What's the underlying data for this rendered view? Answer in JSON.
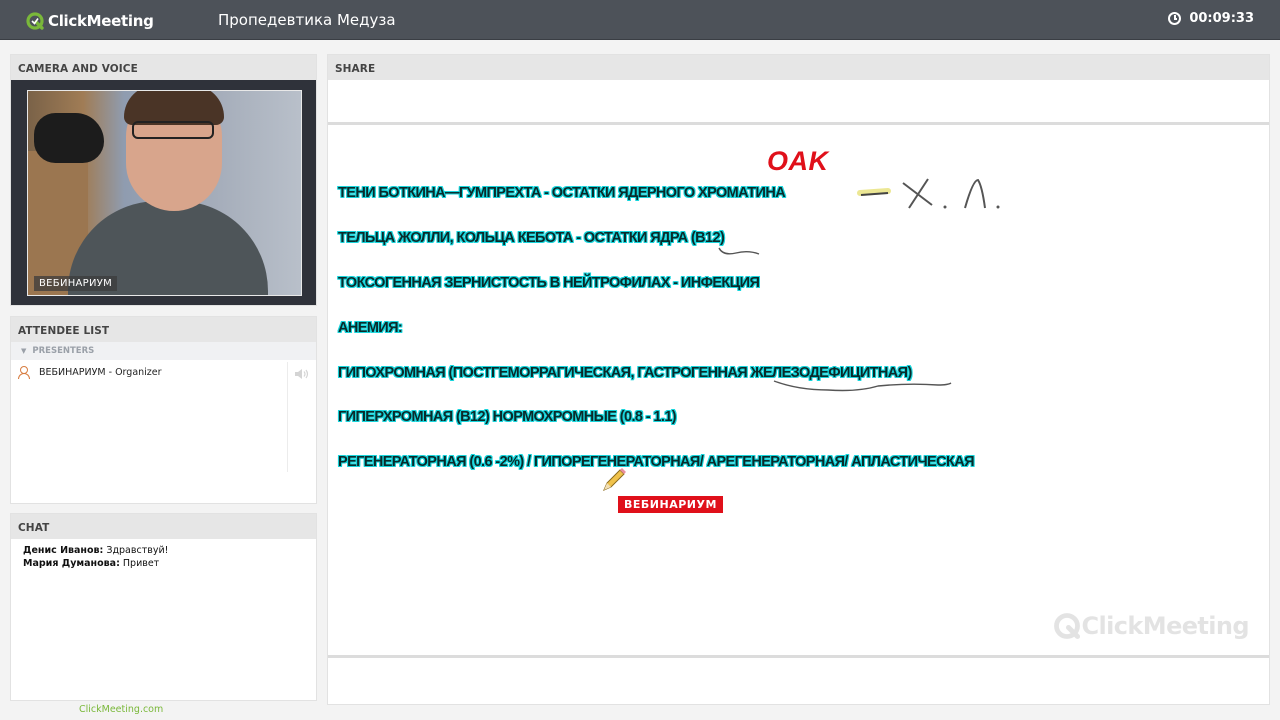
{
  "app": {
    "logo_text": "ClickMeeting",
    "meeting_title": "Пропедевтика  Медуза",
    "timer": "00:09:33"
  },
  "camera": {
    "header": "CAMERA AND VOICE",
    "name_tag": "ВЕБИНАРИУМ"
  },
  "attendees": {
    "header": "ATTENDEE LIST",
    "group_label": "PRESENTERS",
    "list": [
      {
        "name": "ВЕБИНАРИУМ  - Organizer"
      }
    ]
  },
  "chat": {
    "header": "CHAT",
    "messages": [
      {
        "author": "Денис Иванов:",
        "text": " Здравствуй!"
      },
      {
        "author": "Мария Думанова:",
        "text": " Привет"
      }
    ]
  },
  "footer": {
    "link": "ClickMeeting.com"
  },
  "share": {
    "header": "SHARE",
    "slide_title": "OAK",
    "lines": [
      "ТЕНИ БОТКИНА—ГУМПРЕХТА - ОСТАТКИ ЯДЕРНОГО ХРОМАТИНА",
      "ТЕЛЬЦА ЖОЛЛИ, КОЛЬЦА КЕБОТА - ОСТАТКИ ЯДРА (В12)",
      "ТОКСОГЕННАЯ ЗЕРНИСТОСТЬ В НЕЙТРОФИЛАХ - ИНФЕКЦИЯ",
      "АНЕМИЯ:",
      "ГИПОХРОМНАЯ (ПОСТГЕМОРРАГИЧЕСКАЯ, ГАСТРОГЕННАЯ ЖЕЛЕЗОДЕФИЦИТНАЯ)",
      "ГИПЕРХРОМНАЯ (В12) НОРМОХРОМНЫЕ (0.8 - 1.1)",
      "РЕГЕНЕРАТОРНАЯ (0.6 -2%) / ГИПОРЕГЕНЕРАТОРНАЯ/ АРЕГЕНЕРАТОРНАЯ/ АПЛАСТИЧЕСКАЯ"
    ],
    "pointer_label": "ВЕБИНАРИУМ",
    "watermark": "ClickMeeting"
  },
  "colors": {
    "topbar": "#4d5259",
    "accent_green": "#7ab83a",
    "slide_highlight": "#18d5dc",
    "slide_red": "#e0101a"
  },
  "icons": [
    "clickmeeting-logo-icon",
    "clock-icon",
    "person-icon",
    "speaker-icon",
    "pencil-icon"
  ]
}
